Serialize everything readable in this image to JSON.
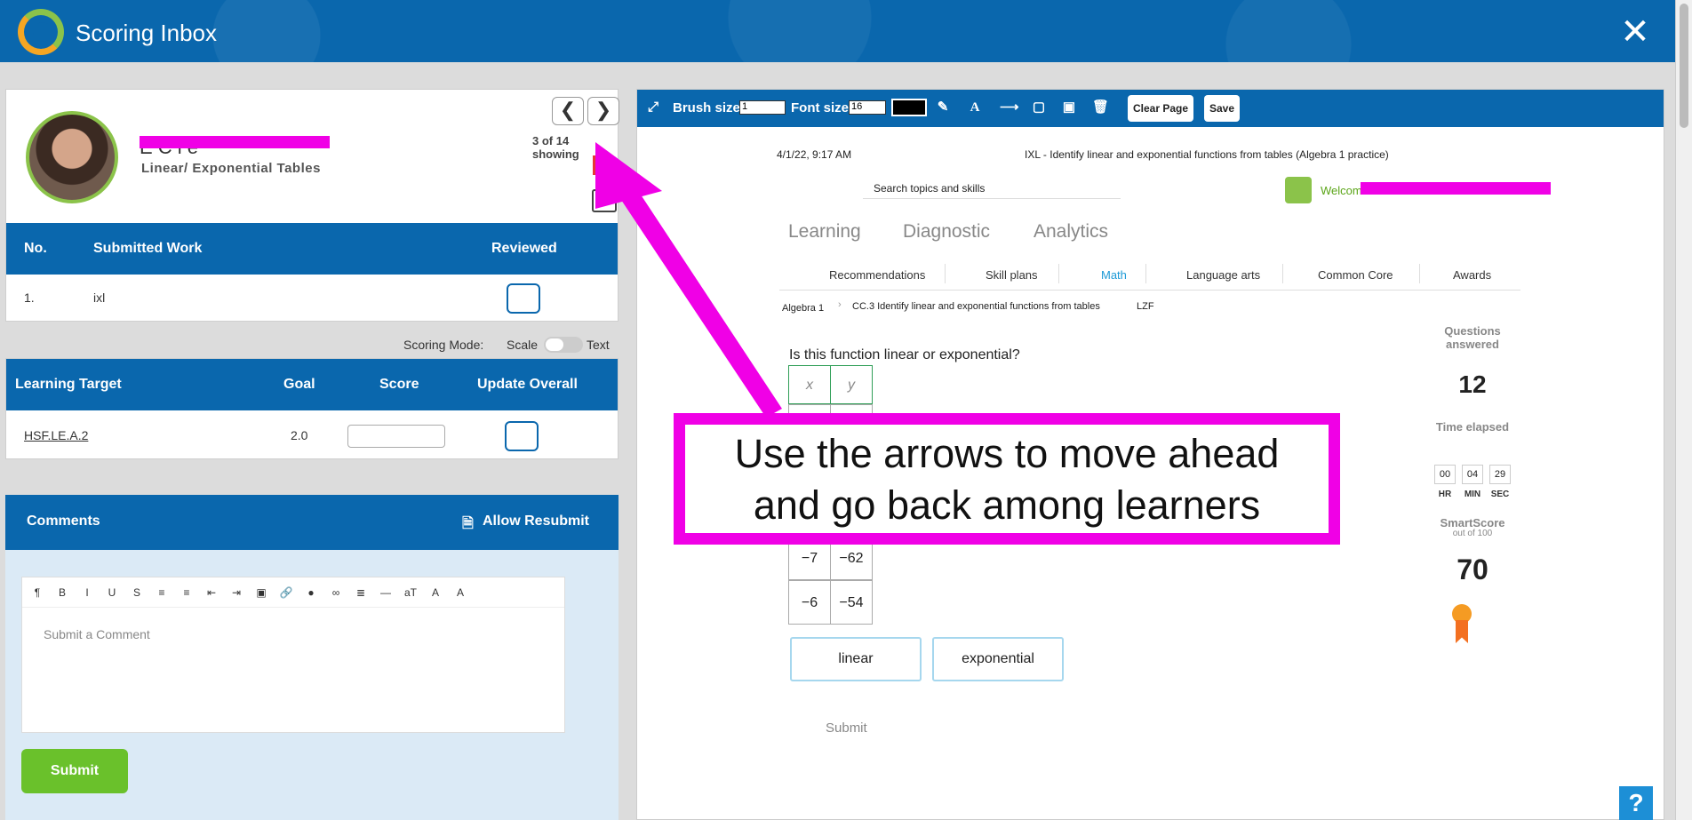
{
  "app": {
    "title": "Scoring Inbox",
    "close": "✕"
  },
  "student": {
    "name": "E     C      l   e",
    "topic": "Linear/ Exponential Tables",
    "showing": "3 of 14 showing",
    "prev": "❮",
    "next": "❯",
    "calendar": "1:1"
  },
  "submitted": {
    "headers": {
      "no": "No.",
      "work": "Submitted Work",
      "reviewed": "Reviewed"
    },
    "rows": [
      {
        "no": "1.",
        "work": "ixl"
      }
    ]
  },
  "scoring_mode": {
    "label": "Scoring Mode:",
    "scale": "Scale",
    "text": "Text"
  },
  "learning_target": {
    "headers": {
      "target": "Learning Target",
      "goal": "Goal",
      "score": "Score",
      "update": "Update Overall"
    },
    "rows": [
      {
        "target": "HSF.LE.A.2",
        "goal": "2.0"
      }
    ]
  },
  "comments": {
    "title": "Comments",
    "allow_resubmit": "Allow Resubmit",
    "placeholder": "Submit a Comment",
    "submit": "Submit",
    "tools": [
      "¶",
      "B",
      "I",
      "U",
      "S",
      "≡",
      "≡",
      "⇤",
      "⇥",
      "▣",
      "🔗",
      "●",
      "∞",
      "≣",
      "—",
      "aT",
      "A",
      "A"
    ]
  },
  "viewer": {
    "brush_size_label": "Brush size",
    "brush_size": "1",
    "font_size_label": "Font size",
    "font_size": "16",
    "clear_page": "Clear Page",
    "save": "Save"
  },
  "doc": {
    "timestamp": "4/1/22, 9:17 AM",
    "page_title": "IXL - Identify linear and exponential functions from tables (Algebra 1 practice)",
    "search": "Search topics and skills",
    "welcome": "Welcom",
    "nav": [
      "Learning",
      "Diagnostic",
      "Analytics"
    ],
    "subnav": [
      "Recommendations",
      "Skill plans",
      "Math",
      "Language arts",
      "Common Core",
      "Awards"
    ],
    "breadcrumb_1": "Algebra 1",
    "breadcrumb_2": "CC.3 Identify linear and exponential functions from tables",
    "breadcrumb_code": "LZF",
    "question": "Is this function linear or exponential?",
    "table_headers": [
      "x",
      "y"
    ],
    "table_rows": [
      [
        "−7",
        "−62"
      ],
      [
        "−6",
        "−54"
      ]
    ],
    "answers": [
      "linear",
      "exponential"
    ],
    "submit": "Submit",
    "questions_answered_label": "Questions answered",
    "questions_answered": "12",
    "time_elapsed_label": "Time elapsed",
    "time": {
      "hr": "00",
      "min": "04",
      "sec": "29"
    },
    "time_units": {
      "hr": "HR",
      "min": "MIN",
      "sec": "SEC"
    },
    "smartscore_label": "SmartScore",
    "smartscore_sub": "out of 100",
    "smartscore": "70"
  },
  "callout": {
    "line1": "Use the arrows to move ahead",
    "line2": "and go back among learners"
  },
  "help": "?",
  "colors": {
    "brand_blue": "#0a67ad",
    "highlight_magenta": "#f000e6",
    "submit_green": "#6ac12b"
  }
}
